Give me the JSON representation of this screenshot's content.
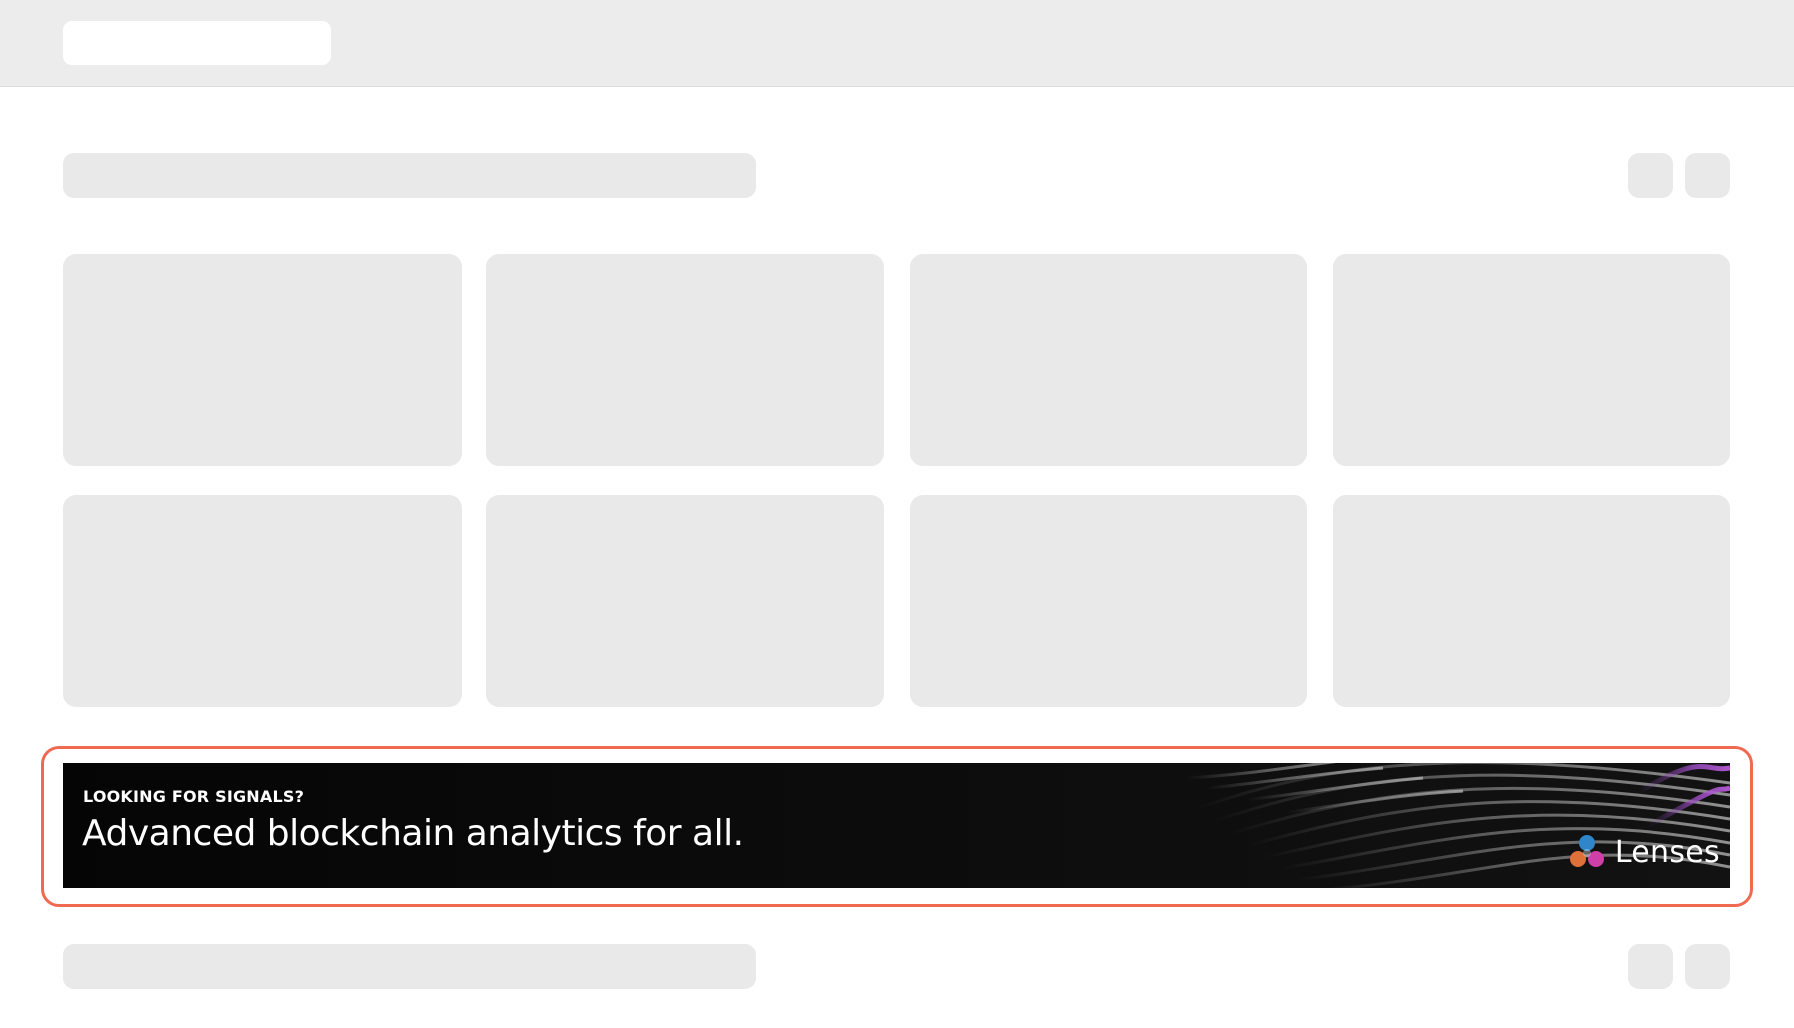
{
  "ad": {
    "eyebrow": "LOOKING FOR SIGNALS?",
    "headline": "Advanced blockchain analytics for all.",
    "brand": "Lenses",
    "brand_icon": "lenses-logo-icon",
    "highlight_color": "#f06a52",
    "background_color": "#0a0a0a"
  },
  "skeleton": {
    "placeholder_color": "#e9e9e9",
    "header_color": "#ececec"
  }
}
